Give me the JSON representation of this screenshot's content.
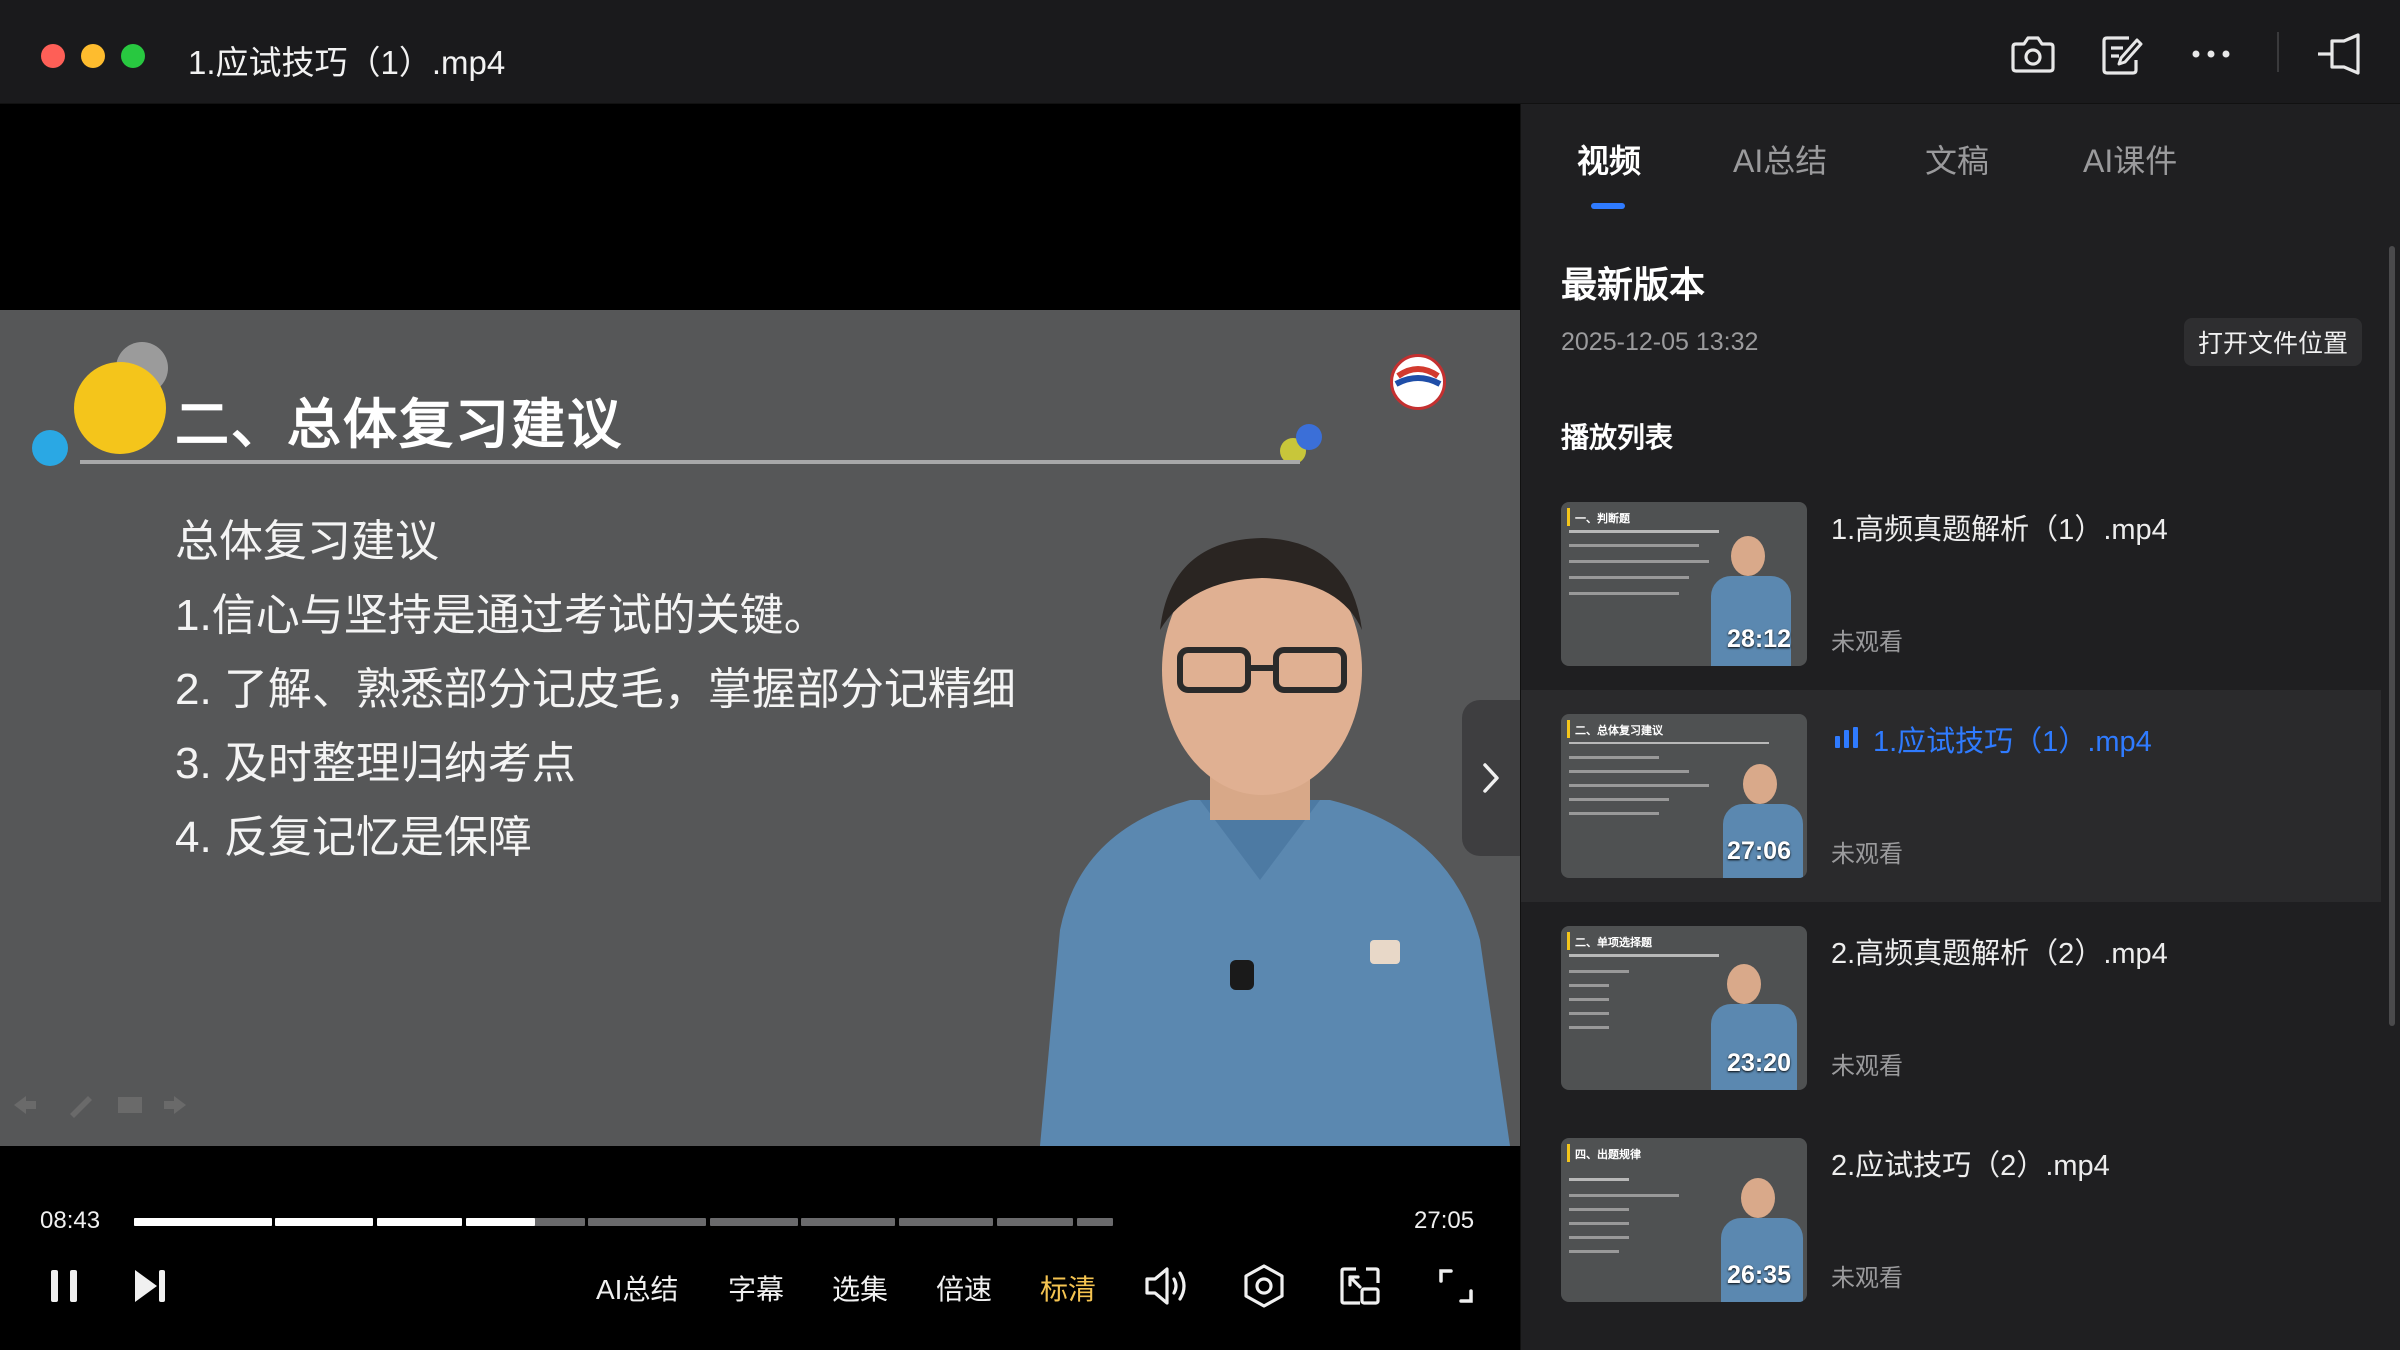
{
  "window": {
    "title": "1.应试技巧（1）.mp4"
  },
  "toolbar": {
    "icons": [
      "camera-icon",
      "note-edit-icon",
      "more-icon",
      "pin-window-icon"
    ]
  },
  "slide": {
    "heading": "二、总体复习建议",
    "lines": [
      "总体复习建议",
      "1.信心与坚持是通过考试的关键。",
      "2. 了解、熟悉部分记皮毛，掌握部分记精细",
      "3.  及时整理归纳考点",
      "4. 反复记忆是保障"
    ]
  },
  "player": {
    "current_time": "08:43",
    "total_time": "27:05",
    "progress_fraction": 0.32,
    "buttons": {
      "ai_summary": "AI总结",
      "subtitles": "字幕",
      "episodes": "选集",
      "speed": "倍速",
      "quality": "标清"
    },
    "quality_color": "#f5c451"
  },
  "panel": {
    "tabs": [
      {
        "label": "视频",
        "active": true
      },
      {
        "label": "AI总结",
        "active": false
      },
      {
        "label": "文稿",
        "active": false
      },
      {
        "label": "AI课件",
        "active": false
      }
    ],
    "version_title": "最新版本",
    "version_date": "2025-12-05 13:32",
    "open_location": "打开文件位置",
    "playlist_title": "播放列表",
    "playlist": [
      {
        "name": "1.高频真题解析（1）.mp4",
        "duration": "28:12",
        "status": "未观看",
        "active": false,
        "thumb_title": "一、判断题"
      },
      {
        "name": "1.应试技巧（1）.mp4",
        "duration": "27:06",
        "status": "未观看",
        "active": true,
        "thumb_title": "二、总体复习建议"
      },
      {
        "name": "2.高频真题解析（2）.mp4",
        "duration": "23:20",
        "status": "未观看",
        "active": false,
        "thumb_title": "二、单项选择题"
      },
      {
        "name": "2.应试技巧（2）.mp4",
        "duration": "26:35",
        "status": "未观看",
        "active": false,
        "thumb_title": "四、出题规律"
      }
    ],
    "accent_color": "#2f7bff"
  }
}
